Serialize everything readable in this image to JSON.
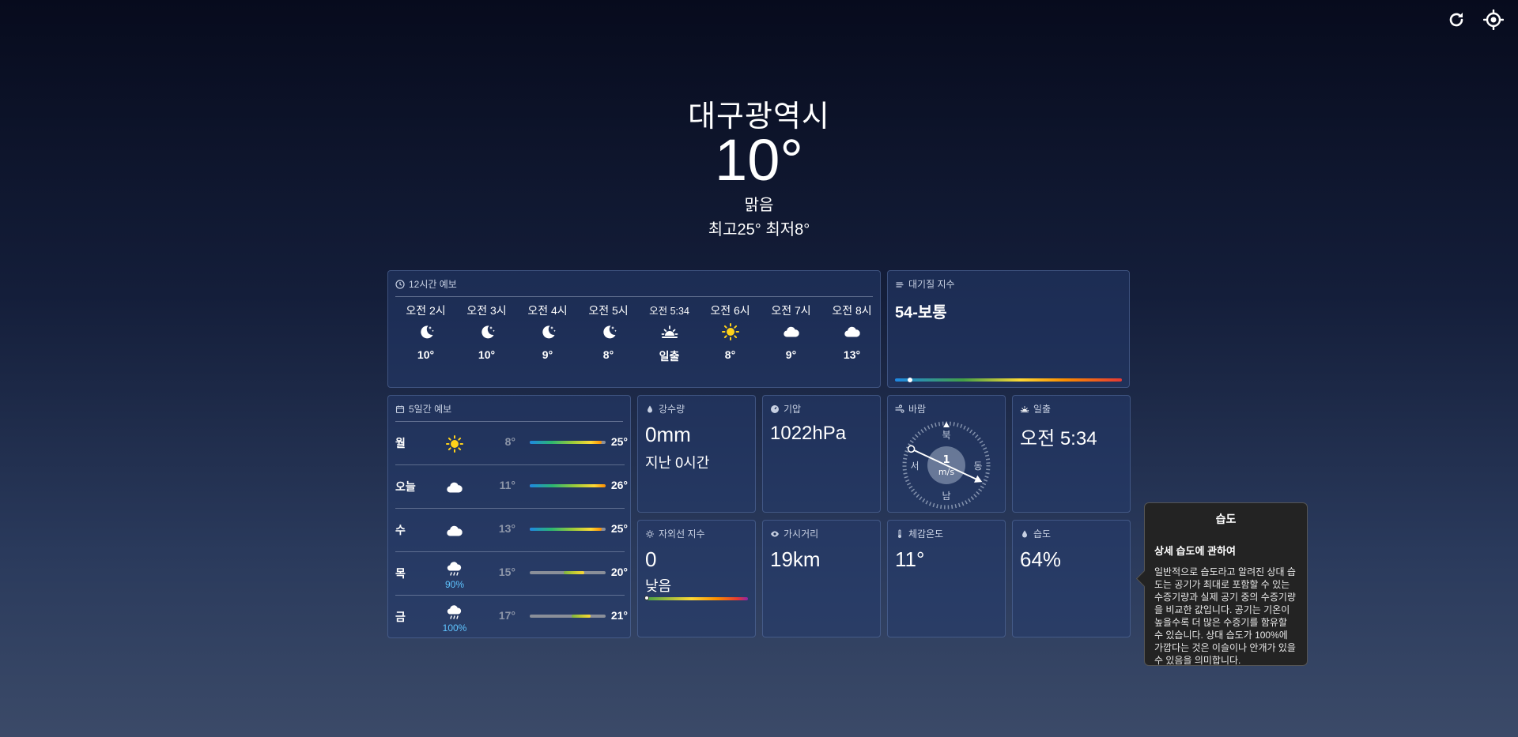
{
  "header": {
    "city": "대구광역시",
    "temperature": "10°",
    "condition": "맑음",
    "hilo": "최고25° 최저8°"
  },
  "toolbar": {
    "refresh_icon": "refresh-icon",
    "location_icon": "crosshair-location-icon"
  },
  "hourly": {
    "title": "12시간 예보",
    "items": [
      {
        "time": "오전 2시",
        "icon": "moon-stars-icon",
        "value": "10°"
      },
      {
        "time": "오전 3시",
        "icon": "moon-stars-icon",
        "value": "10°"
      },
      {
        "time": "오전 4시",
        "icon": "moon-stars-icon",
        "value": "9°"
      },
      {
        "time": "오전 5시",
        "icon": "moon-stars-icon",
        "value": "8°"
      },
      {
        "time": "오전 5:34",
        "icon": "sunrise-icon",
        "value": "일출"
      },
      {
        "time": "오전 6시",
        "icon": "sun-icon",
        "value": "8°"
      },
      {
        "time": "오전 7시",
        "icon": "cloud-icon",
        "value": "9°"
      },
      {
        "time": "오전 8시",
        "icon": "cloud-icon",
        "value": "13°"
      }
    ]
  },
  "aqi": {
    "title": "대기질 지수",
    "value": "54-보통",
    "position": 0.055
  },
  "fiveday": {
    "title": "5일간 예보",
    "days": [
      {
        "day": "월",
        "icon": "sun-icon",
        "pop": "",
        "low": "8°",
        "high": "25°",
        "from": 0.0,
        "to": 0.95
      },
      {
        "day": "오늘",
        "icon": "cloud-icon",
        "pop": "",
        "low": "11°",
        "high": "26°",
        "from": 0.0,
        "to": 1.0
      },
      {
        "day": "수",
        "icon": "cloud-icon",
        "pop": "",
        "low": "13°",
        "high": "25°",
        "from": 0.0,
        "to": 0.95
      },
      {
        "day": "목",
        "icon": "rain-cloud-icon",
        "pop": "90%",
        "low": "15°",
        "high": "20°",
        "from": 0.45,
        "to": 0.72
      },
      {
        "day": "금",
        "icon": "rain-cloud-icon",
        "pop": "100%",
        "low": "17°",
        "high": "21°",
        "from": 0.55,
        "to": 0.8
      }
    ]
  },
  "precip": {
    "title": "강수량",
    "value": "0mm",
    "sub": "지난 0시간"
  },
  "pressure": {
    "title": "기압",
    "value": "1022hPa"
  },
  "wind": {
    "title": "바람",
    "speed": "1",
    "unit": "m/s",
    "n": "북",
    "s": "남",
    "e": "동",
    "w": "서",
    "direction_deg": 295
  },
  "sunrise": {
    "title": "일출",
    "value": "오전 5:34"
  },
  "uv": {
    "title": "자외선 지수",
    "value": "0",
    "level": "낮음"
  },
  "visibility": {
    "title": "가시거리",
    "value": "19km"
  },
  "feels": {
    "title": "체감온도",
    "value": "11°"
  },
  "humidity": {
    "title": "습도",
    "value": "64%"
  },
  "tooltip": {
    "title": "습도",
    "heading": "상세 습도에 관하여",
    "body": "일반적으로 습도라고 알려진 상대 습도는 공기가 최대로 포함할 수 있는 수증기량과 실제 공기 중의 수증기량을 비교한 값입니다. 공기는 기온이 높을수록 더 많은 수증기를 함유할 수 있습니다. 상대 습도가 100%에 가깝다는 것은 이슬이나 안개가 있을 수 있음을 의미합니다."
  },
  "colors": {
    "accent_rain": "#5fc4ff",
    "sun": "#ffd21a"
  }
}
